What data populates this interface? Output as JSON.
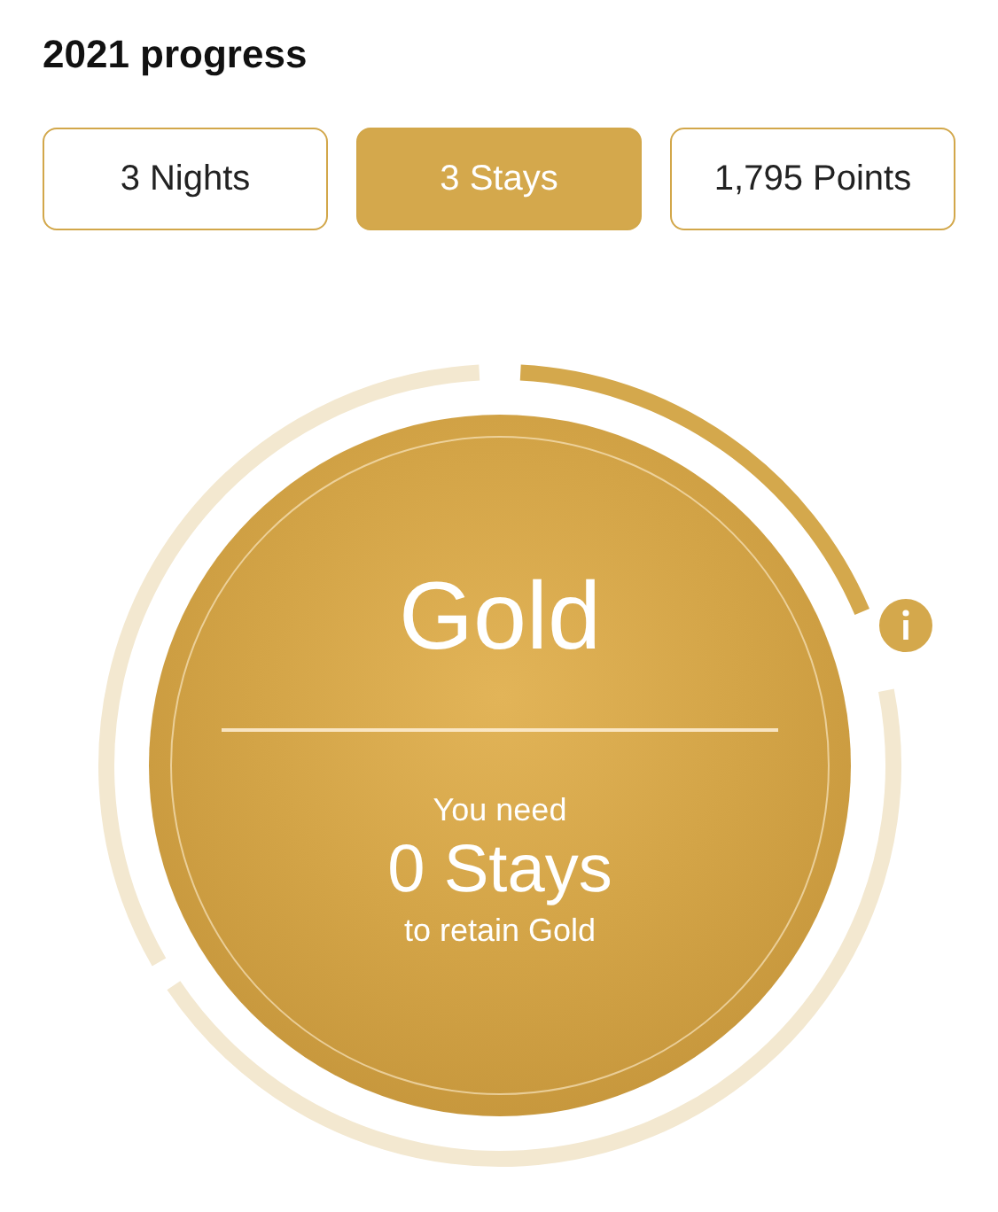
{
  "title": "2021 progress",
  "tabs": [
    {
      "label": "3 Nights",
      "selected": false
    },
    {
      "label": "3 Stays",
      "selected": true
    },
    {
      "label": "1,795 Points",
      "selected": false
    }
  ],
  "status": {
    "tier": "Gold",
    "lead": "You need",
    "count": "0 Stays",
    "tail": "to retain Gold"
  }
}
